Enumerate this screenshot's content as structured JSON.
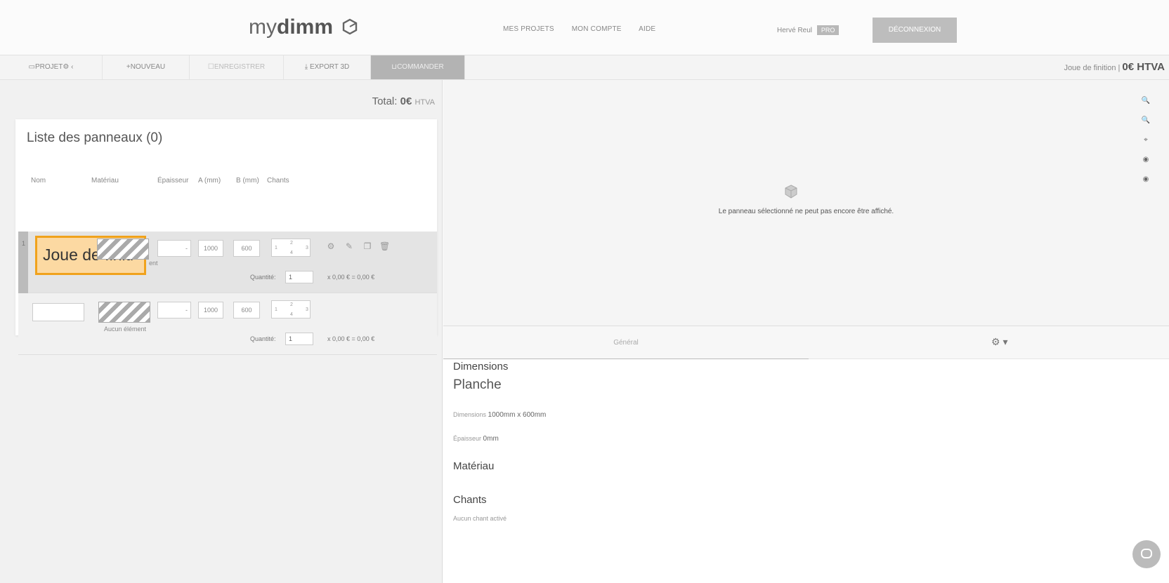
{
  "header": {
    "logo_light": "my",
    "logo_bold": "dimm",
    "nav": [
      "MES PROJETS",
      "MON COMPTE",
      "AIDE"
    ],
    "user_name": "Hervé Reul",
    "user_badge": "PRO",
    "logout_label": "DÉCONNEXION"
  },
  "toolbar": {
    "project_label": "PROJET",
    "new_label": "NOUVEAU",
    "save_label": "ENREGISTRER",
    "export_label": "EXPORT 3D",
    "order_label": "COMMANDER",
    "panel_name": "Joue de finition |",
    "panel_price": "0€ HTVA"
  },
  "left": {
    "total_label": "Total:",
    "total_value": "0€",
    "total_suffix": "HTVA",
    "list_title": "Liste des panneaux (0)",
    "columns": [
      "Nom",
      "Matériau",
      "Épaisseur",
      "A (mm)",
      "B (mm)",
      "Chants"
    ],
    "rows": [
      {
        "index": "1",
        "name": "Joue de finiti",
        "material_label": "Aucun élément",
        "thickness": "-",
        "a": "1000",
        "b": "600",
        "chant_top": "2",
        "chant_left": "1",
        "chant_right": "3",
        "chant_bottom": "4",
        "qty_label": "Quantité:",
        "qty": "1",
        "price": "x 0,00 € = 0,00 €"
      },
      {
        "index": "",
        "name": "",
        "material_label": "Aucun élément",
        "thickness": "-",
        "a": "1000",
        "b": "600",
        "chant_top": "2",
        "chant_left": "1",
        "chant_right": "3",
        "chant_bottom": "4",
        "qty_label": "Quantité:",
        "qty": "1",
        "price": "x 0,00 € = 0,00 €"
      }
    ]
  },
  "viewer": {
    "message": "Le panneau sélectionné ne peut pas encore être affiché."
  },
  "tabs": {
    "general": "Général"
  },
  "details": {
    "dimensions_title": "Dimensions",
    "type": "Planche",
    "dimensions_label": "Dimensions",
    "dimensions_value": "1000mm x 600mm",
    "thickness_label": "Épaisseur",
    "thickness_value": "0mm",
    "material_title": "Matériau",
    "chants_title": "Chants",
    "chants_value": "Aucun chant activé"
  }
}
